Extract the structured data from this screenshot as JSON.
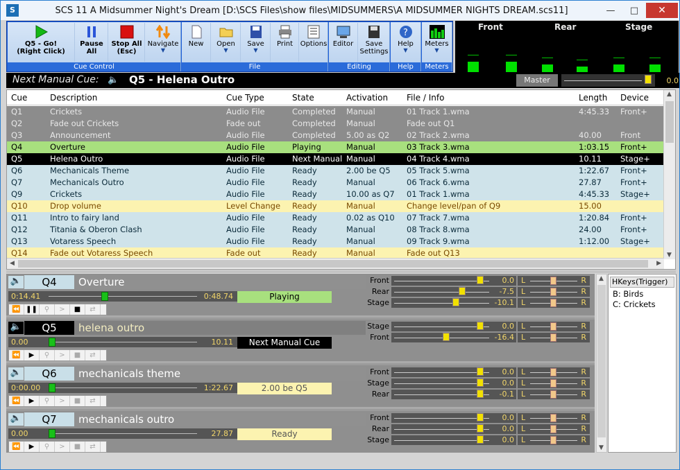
{
  "window": {
    "title": "SCS 11  A Midsummer Night's Dream [D:\\SCS Files\\show files\\MIDSUMMERS\\A MIDSUMMER NIGHTS DREAM.scs11]",
    "app_icon": "S"
  },
  "toolbar": {
    "groups": {
      "cue_control": "Cue Control",
      "file": "File",
      "editing": "Editing",
      "help": "Help",
      "meters": "Meters"
    },
    "go": {
      "line1": "Q5 - Go!",
      "line2": "(Right Click)"
    },
    "pause": {
      "line1": "Pause",
      "line2": "All"
    },
    "stop": {
      "line1": "Stop All",
      "line2": "(Esc)"
    },
    "navigate": "Navigate",
    "new": "New",
    "open": "Open",
    "save": "Save",
    "print": "Print",
    "options": "Options",
    "editor": "Editor",
    "save_settings": {
      "line1": "Save",
      "line2": "Settings"
    },
    "help_btn": "Help",
    "meters_btn": "Meters"
  },
  "meters": {
    "labels": [
      "Front",
      "Rear",
      "Stage"
    ],
    "levels": [
      0.22,
      0.21,
      0.0,
      0.16,
      0.12,
      0.0,
      0.16,
      0.15,
      0.0,
      0.16,
      0.12,
      0.0
    ]
  },
  "next": {
    "label": "Next Manual Cue:",
    "cue": "Q5 - Helena Outro",
    "master_label": "Master",
    "master_value": "0.0"
  },
  "cuelist": {
    "headers": [
      "Cue",
      "Description",
      "Cue Type",
      "State",
      "Activation",
      "File / Info",
      "Length",
      "Device"
    ],
    "rows": [
      {
        "cue": "Q1",
        "desc": "Crickets",
        "type": "Audio File",
        "state": "Completed",
        "act": "Manual",
        "file": "01 Track 1.wma",
        "len": "4:45.33",
        "dev": "Front+",
        "style": "completed"
      },
      {
        "cue": "Q2",
        "desc": "Fade out Crickets",
        "type": "Fade out",
        "state": "Completed",
        "act": "Manual",
        "file": "Fade out Q1",
        "len": "",
        "dev": "",
        "style": "completed"
      },
      {
        "cue": "Q3",
        "desc": "Announcement",
        "type": "Audio File",
        "state": "Completed",
        "act": "5.00 as Q2",
        "file": "02 Track 2.wma",
        "len": "40.00",
        "dev": "Front",
        "style": "completed"
      },
      {
        "cue": "Q4",
        "desc": "Overture",
        "type": "Audio File",
        "state": "Playing",
        "act": "Manual",
        "file": "03 Track 3.wma",
        "len": "1:03.15",
        "dev": "Front+",
        "style": "playing"
      },
      {
        "cue": "Q5",
        "desc": "Helena Outro",
        "type": "Audio File",
        "state": "Next Manual",
        "act": "Manual",
        "file": "04 Track 4.wma",
        "len": "10.11",
        "dev": "Stage+",
        "style": "next"
      },
      {
        "cue": "Q6",
        "desc": "Mechanicals Theme",
        "type": "Audio File",
        "state": "Ready",
        "act": "2.00 be Q5",
        "file": "05 Track 5.wma",
        "len": "1:22.67",
        "dev": "Front+",
        "style": "ready"
      },
      {
        "cue": "Q7",
        "desc": "Mechanicals Outro",
        "type": "Audio File",
        "state": "Ready",
        "act": "Manual",
        "file": "06 Track 6.wma",
        "len": "27.87",
        "dev": "Front+",
        "style": "ready"
      },
      {
        "cue": "Q9",
        "desc": "Crickets",
        "type": "Audio File",
        "state": "Ready",
        "act": "10.00 as Q7",
        "file": "01 Track 1.wma",
        "len": "4:45.33",
        "dev": "Stage+",
        "style": "ready"
      },
      {
        "cue": "Q10",
        "desc": "Drop volume",
        "type": "Level Change",
        "state": "Ready",
        "act": "Manual",
        "file": "Change level/pan of Q9",
        "len": "15.00",
        "dev": "",
        "style": "level"
      },
      {
        "cue": "Q11",
        "desc": "Intro to fairy land",
        "type": "Audio File",
        "state": "Ready",
        "act": "0.02 as Q10",
        "file": "07 Track 7.wma",
        "len": "1:20.84",
        "dev": "Front+",
        "style": "ready"
      },
      {
        "cue": "Q12",
        "desc": "Titania & Oberon Clash",
        "type": "Audio File",
        "state": "Ready",
        "act": "Manual",
        "file": "08 Track 8.wma",
        "len": "24.00",
        "dev": "Front+",
        "style": "ready"
      },
      {
        "cue": "Q13",
        "desc": "Votaress Speech",
        "type": "Audio File",
        "state": "Ready",
        "act": "Manual",
        "file": "09 Track 9.wma",
        "len": "1:12.00",
        "dev": "Stage+",
        "style": "ready"
      },
      {
        "cue": "Q14",
        "desc": "Fade out Votaress Speech",
        "type": "Fade out",
        "state": "Ready",
        "act": "Manual",
        "file": "Fade out Q13",
        "len": "",
        "dev": "",
        "style": "level"
      }
    ]
  },
  "panels": [
    {
      "cue": "Q4",
      "desc": "Overture",
      "pos": "0:14.41",
      "len": "0:48.74",
      "progress": 0.38,
      "state": "Playing",
      "style": "playing",
      "devices": [
        {
          "name": "Front",
          "db": "0.0",
          "level": 0.93
        },
        {
          "name": "Rear",
          "db": "-7.5",
          "level": 0.73
        },
        {
          "name": "Stage",
          "db": "-10.1",
          "level": 0.66
        }
      ]
    },
    {
      "cue": "Q5",
      "desc": "helena outro",
      "pos": "0.00",
      "len": "10.11",
      "progress": 0.0,
      "state": "Next Manual Cue",
      "style": "next",
      "devices": [
        {
          "name": "Stage",
          "db": "0.0",
          "level": 0.93
        },
        {
          "name": "Front",
          "db": "-16.4",
          "level": 0.55
        }
      ]
    },
    {
      "cue": "Q6",
      "desc": "mechanicals theme",
      "pos": "0:00.00",
      "len": "1:22.67",
      "progress": 0.0,
      "state": "2.00 be Q5",
      "style": "ready",
      "devices": [
        {
          "name": "Front",
          "db": "0.0",
          "level": 0.93
        },
        {
          "name": "Stage",
          "db": "0.0",
          "level": 0.93
        },
        {
          "name": "Rear",
          "db": "-0.1",
          "level": 0.93
        }
      ]
    },
    {
      "cue": "Q7",
      "desc": "mechanicals outro",
      "pos": "0.00",
      "len": "27.87",
      "progress": 0.0,
      "state": "Ready",
      "style": "ready",
      "devices": [
        {
          "name": "Front",
          "db": "0.0",
          "level": 0.93
        },
        {
          "name": "Rear",
          "db": "0.0",
          "level": 0.93
        },
        {
          "name": "Stage",
          "db": "0.0",
          "level": 0.93
        }
      ]
    }
  ],
  "pan": {
    "left": "L",
    "right": "R"
  },
  "hotkeys": {
    "header": "HKeys(Trigger)",
    "items": [
      "B: Birds",
      "C: Crickets"
    ]
  },
  "colors": {
    "completed": "#8c8c8c",
    "playing": "#a8e07e",
    "next": "#000000",
    "ready": "#cfe3ea",
    "level": "#fcf3b0",
    "accent": "#1f5fd8"
  },
  "icons": {
    "go": "play-icon",
    "pause": "pause-icon",
    "stop": "stop-icon",
    "navigate": "navigate-icon",
    "speaker": "speaker-icon"
  }
}
